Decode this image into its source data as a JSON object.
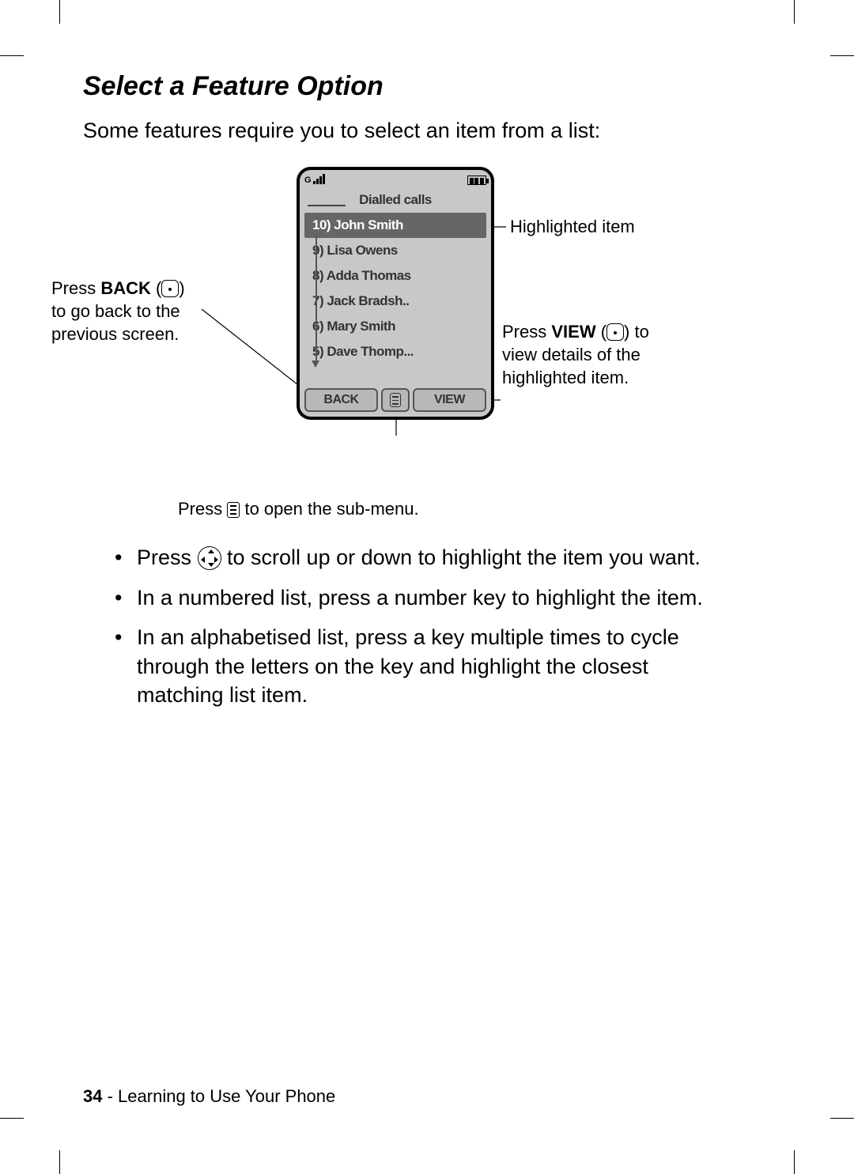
{
  "heading": "Select a Feature Option",
  "intro": "Some features require you to select an item from a list:",
  "phone": {
    "title": "Dialled calls",
    "items": [
      "10) John Smith",
      "9) Lisa Owens",
      "8) Adda Thomas",
      "7) Jack Bradsh..",
      "6) Mary Smith",
      "5) Dave Thomp..."
    ],
    "highlighted_index": 0,
    "soft_left": "BACK",
    "soft_right": "VIEW"
  },
  "callouts": {
    "left_back_pre": "Press ",
    "left_back_bold": "BACK",
    "left_back_post": " (",
    "left_back_tail": ") to go back to the previous screen.",
    "right_highlight": "Highlighted item",
    "right_view_pre": "Press ",
    "right_view_bold": "VIEW",
    "right_view_post": " (",
    "right_view_tail": ") to view details of the highlighted item.",
    "bottom_menu_pre": "Press ",
    "bottom_menu_post": " to open the sub-menu."
  },
  "bullets": {
    "b1_pre": "Press ",
    "b1_post": " to scroll up or down to highlight the item you want.",
    "b2": "In a numbered list, press a number key to highlight the item.",
    "b3": "In an alphabetised list, press a key multiple times to cycle through the letters on the key and highlight the closest matching list item."
  },
  "footer": {
    "page": "34",
    "sep": " - ",
    "chapter": "Learning to Use Your Phone"
  }
}
